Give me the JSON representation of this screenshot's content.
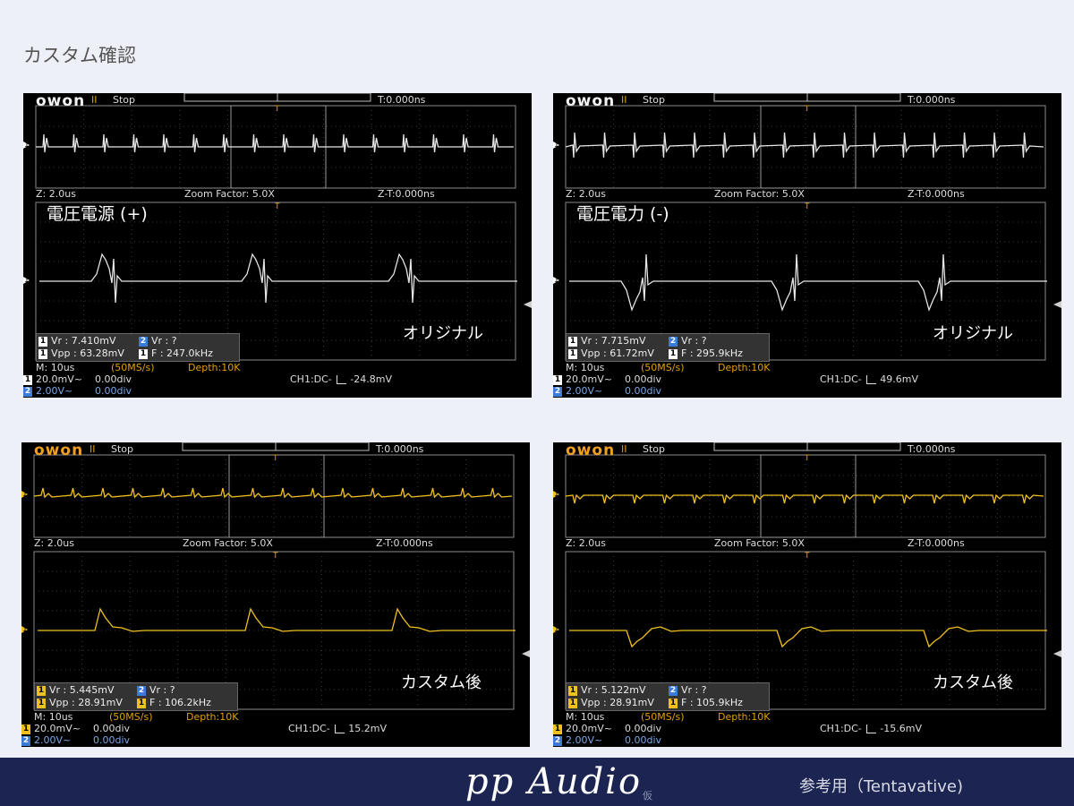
{
  "page": {
    "title": "カスタム確認"
  },
  "footer": {
    "brand": "pp Audio",
    "mark": "仮",
    "note": "参考用（Tentavative)"
  },
  "scopes": [
    {
      "logo": "owon",
      "status_icon": "II",
      "status": "Stop",
      "time": "T:0.000ns",
      "trig_marker": "T",
      "ch_marker": "1",
      "zoom": {
        "z": "Z: 2.0us",
        "factor": "Zoom Factor: 5.0X",
        "zt": "Z-T:0.000ns"
      },
      "title": "電圧電源 (+)",
      "label": "オリジナル",
      "meas": {
        "vr1": "Vr : 7.410mV",
        "vr2": "Vr :     ?",
        "vpp": "Vpp : 63.28mV",
        "f": "F : 247.0kHz"
      },
      "bottom": {
        "m": "M: 10us",
        "rate": "(50MS/s)",
        "depth": "Depth:10K",
        "ch1": "20.0mV~",
        "ch1off": "0.00div",
        "ch2": "2.00V~",
        "ch2off": "0.00div",
        "trig": "CH1:DC-",
        "trig_val": "-24.8mV"
      },
      "colors": {
        "trace": "#e6e6e6",
        "logo": "#f2f2f2",
        "ch1": "#ffffff"
      }
    },
    {
      "logo": "owon",
      "status_icon": "II",
      "status": "Stop",
      "time": "T:0.000ns",
      "trig_marker": "T",
      "ch_marker": "1",
      "zoom": {
        "z": "Z: 2.0us",
        "factor": "Zoom Factor: 5.0X",
        "zt": "Z-T:0.000ns"
      },
      "title": "電圧電力 (-)",
      "label": "オリジナル",
      "meas": {
        "vr1": "Vr : 7.715mV",
        "vr2": "Vr :     ?",
        "vpp": "Vpp : 61.72mV",
        "f": "F : 295.9kHz"
      },
      "bottom": {
        "m": "M: 10us",
        "rate": "(50MS/s)",
        "depth": "Depth:10K",
        "ch1": "20.0mV~",
        "ch1off": "0.00div",
        "ch2": "2.00V~",
        "ch2off": "0.00div",
        "trig": "CH1:DC-",
        "trig_val": "49.6mV"
      },
      "colors": {
        "trace": "#e6e6e6",
        "logo": "#f2f2f2",
        "ch1": "#ffffff"
      }
    },
    {
      "logo": "owon",
      "status_icon": "II",
      "status": "Stop",
      "time": "T:0.000ns",
      "trig_marker": "T",
      "ch_marker": "1",
      "zoom": {
        "z": "Z: 2.0us",
        "factor": "Zoom Factor: 5.0X",
        "zt": "Z-T:0.000ns"
      },
      "title": "",
      "label": "カスタム後",
      "meas": {
        "vr1": "Vr : 5.445mV",
        "vr2": "Vr :     ?",
        "vpp": "Vpp : 28.91mV",
        "f": "F : 106.2kHz"
      },
      "bottom": {
        "m": "M: 10us",
        "rate": "(50MS/s)",
        "depth": "Depth:10K",
        "ch1": "20.0mV~",
        "ch1off": "0.00div",
        "ch2": "2.00V~",
        "ch2off": "0.00div",
        "trig": "CH1:DC-",
        "trig_val": "15.2mV"
      },
      "colors": {
        "trace": "#f0c020",
        "logo": "#f0a020",
        "ch1": "#f0c020"
      }
    },
    {
      "logo": "owon",
      "status_icon": "II",
      "status": "Stop",
      "time": "T:0.000ns",
      "trig_marker": "T",
      "ch_marker": "1",
      "zoom": {
        "z": "Z: 2.0us",
        "factor": "Zoom Factor: 5.0X",
        "zt": "Z-T:0.000ns"
      },
      "title": "",
      "label": "カスタム後",
      "meas": {
        "vr1": "Vr : 5.122mV",
        "vr2": "Vr :     ?",
        "vpp": "Vpp : 28.91mV",
        "f": "F : 105.9kHz"
      },
      "bottom": {
        "m": "M: 10us",
        "rate": "(50MS/s)",
        "depth": "Depth:10K",
        "ch1": "20.0mV~",
        "ch1off": "0.00div",
        "ch2": "2.00V~",
        "ch2off": "0.00div",
        "trig": "CH1:DC-",
        "trig_val": "-15.6mV"
      },
      "colors": {
        "trace": "#f0c020",
        "logo": "#f0a020",
        "ch1": "#f0c020"
      }
    }
  ]
}
